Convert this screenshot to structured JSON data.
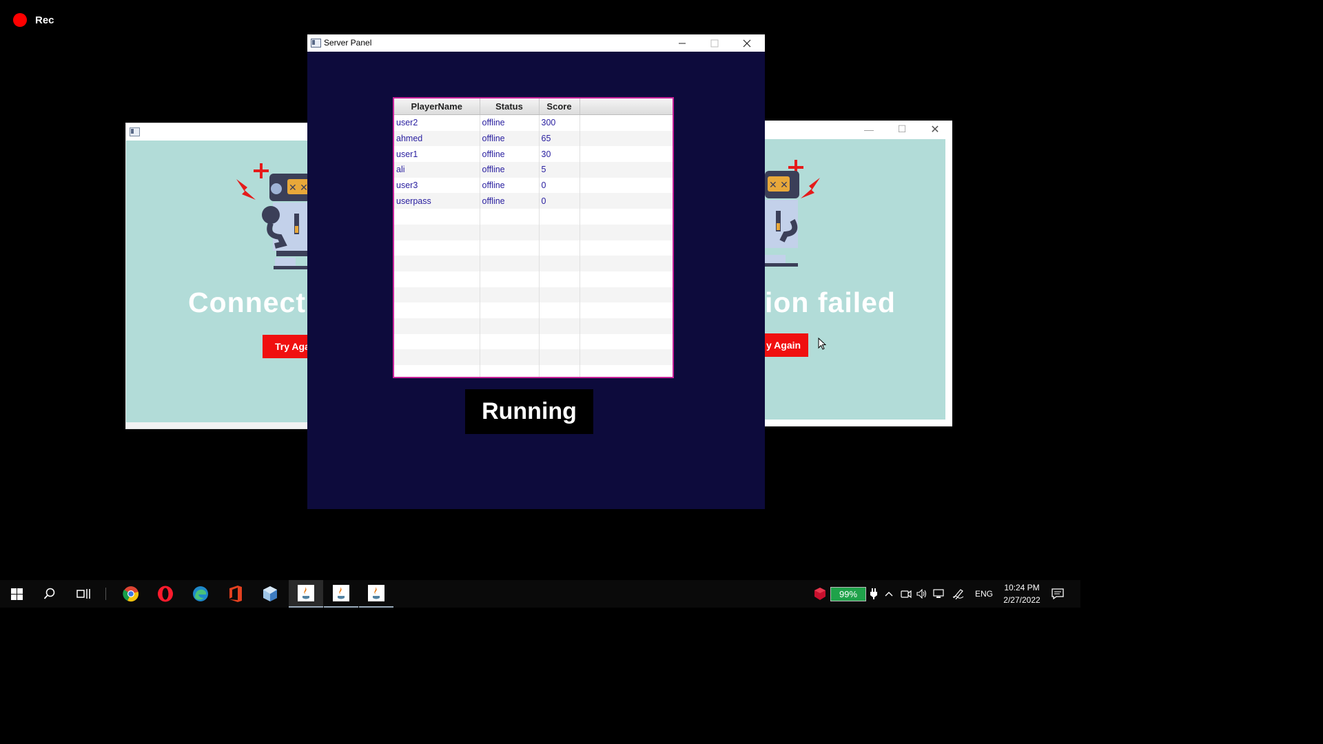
{
  "recording": {
    "label": "Rec"
  },
  "server_window": {
    "title": "Server Panel",
    "table": {
      "columns": [
        "PlayerName",
        "Status",
        "Score"
      ],
      "rows": [
        [
          "user2",
          "offline",
          "300"
        ],
        [
          "ahmed",
          "offline",
          "65"
        ],
        [
          "user1",
          "offline",
          "30"
        ],
        [
          "ali",
          "offline",
          "5"
        ],
        [
          "user3",
          "offline",
          "0"
        ],
        [
          "userpass",
          "offline",
          "0"
        ]
      ]
    },
    "status_label": "Running"
  },
  "client_left": {
    "message": "Connectio",
    "button_label": "Try Agai"
  },
  "client_right": {
    "message": "ion failed",
    "button_label": "y Again"
  },
  "taskbar": {
    "battery": "99%",
    "language": "ENG",
    "time": "10:24 PM",
    "date": "2/27/2022"
  },
  "colors": {
    "server_bg": "#0d0b3c",
    "table_border": "#c8229a",
    "client_bg": "#b2dcd8",
    "button_red": "#f01010"
  }
}
